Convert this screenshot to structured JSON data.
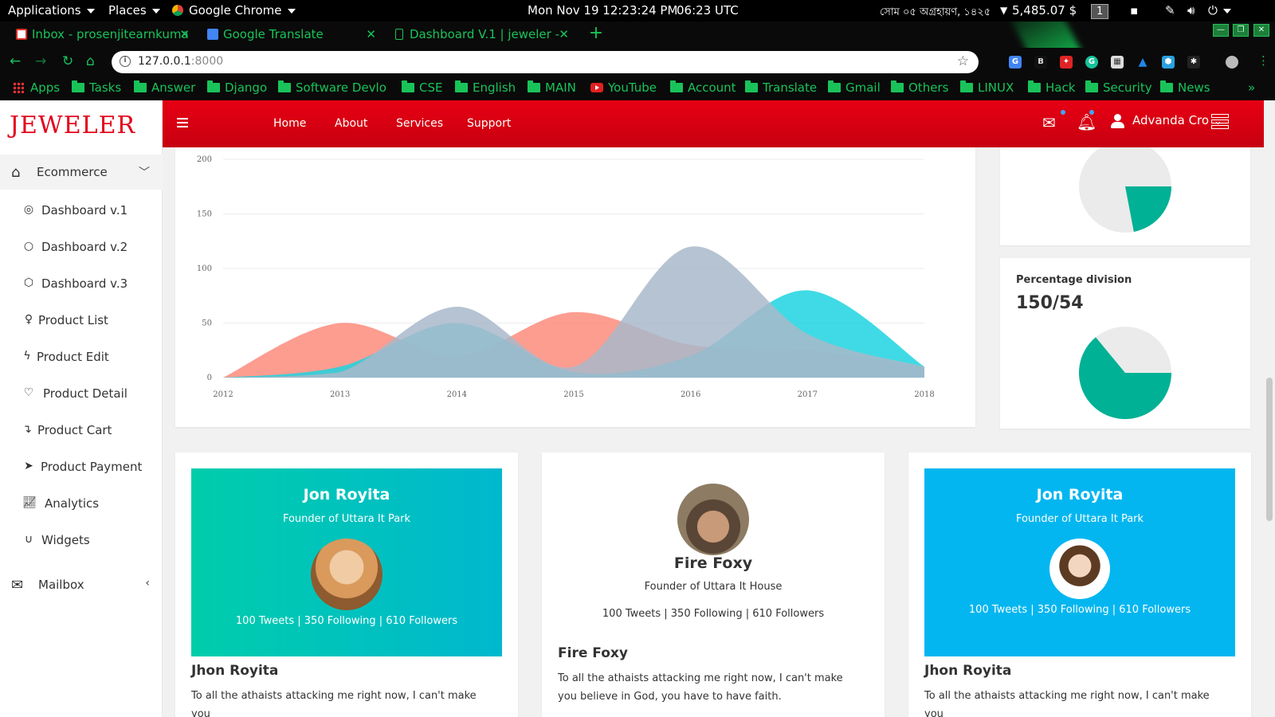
{
  "os": {
    "applications": "Applications",
    "places": "Places",
    "browser": "Google Chrome",
    "datetime": "Mon Nov 19  12:23:24 PM",
    "utc": "06:23 UTC",
    "bengali_date": "সোম ০৫ অগ্রহায়ণ, ১৪২৫",
    "balance": "5,485.07 $",
    "workspace": "1"
  },
  "tabs": [
    {
      "title": "Inbox - prosenjitearnkuma",
      "icon": "gmail-icon"
    },
    {
      "title": "Google Translate",
      "icon": "translate-icon"
    },
    {
      "title": "Dashboard V.1 | jeweler -",
      "icon": "page-icon"
    }
  ],
  "address": {
    "host": "127.0.0.1",
    "port": ":8000"
  },
  "bookmarks": [
    "Apps",
    "Tasks",
    "Answer",
    "Django",
    "Software Devlop",
    "CSE",
    "English",
    "MAIN",
    "YouTube",
    "Account",
    "Translate",
    "Gmail",
    "Others",
    "LINUX",
    "Hack",
    "Security",
    "News"
  ],
  "bookmarks_more": "»",
  "sidebar": {
    "logo": "JEWELER",
    "ecommerce": "Ecommerce",
    "items": [
      {
        "label": "Dashboard v.1",
        "icon": "target-icon"
      },
      {
        "label": "Dashboard v.2",
        "icon": "circle-icon"
      },
      {
        "label": "Dashboard v.3",
        "icon": "cube-icon"
      },
      {
        "label": "Product List",
        "icon": "female-icon"
      },
      {
        "label": "Product Edit",
        "icon": "bolt-icon"
      },
      {
        "label": "Product Detail",
        "icon": "heart-icon"
      },
      {
        "label": "Product Cart",
        "icon": "level-down-icon"
      },
      {
        "label": "Product Payment",
        "icon": "send-icon"
      },
      {
        "label": "Analytics",
        "icon": "line-chart-icon"
      },
      {
        "label": "Widgets",
        "icon": "magnet-icon"
      }
    ],
    "mailbox": "Mailbox"
  },
  "topnav": {
    "links": [
      "Home",
      "About",
      "Services",
      "Support"
    ],
    "user": "Advanda Cro"
  },
  "chart_data": {
    "type": "area",
    "x": [
      "2012",
      "2013",
      "2014",
      "2015",
      "2016",
      "2017",
      "2018"
    ],
    "ylim": [
      0,
      200
    ],
    "yticks": [
      0,
      50,
      100,
      150,
      200
    ],
    "grid": true,
    "series": [
      {
        "values": [
          0,
          50,
          20,
          60,
          30,
          25,
          10
        ],
        "color": "#fb8c7c"
      },
      {
        "values": [
          0,
          10,
          50,
          5,
          20,
          80,
          10
        ],
        "color": "#1dd3e0"
      },
      {
        "values": [
          0,
          5,
          65,
          10,
          120,
          40,
          10
        ],
        "color": "#a9b9ca"
      }
    ]
  },
  "pie1": {
    "fraction": 0.22,
    "color": "#00b195",
    "bg": "#ebebeb"
  },
  "pie2": {
    "title": "Percentage division",
    "value": "150/54",
    "fraction": 0.64,
    "color": "#00b195",
    "bg": "#ebebeb"
  },
  "profiles": [
    {
      "hero_name": "Jon Royita",
      "hero_role": "Founder of Uttara It Park",
      "stats": "100 Tweets | 350 Following | 610 Followers",
      "name": "Jhon Royita",
      "desc": "To all the athaists attacking me right now, I can't make you"
    },
    {
      "center_name": "Fire Foxy",
      "center_role": "Founder of Uttara It House",
      "stats": "100 Tweets | 350 Following | 610 Followers",
      "name": "Fire Foxy",
      "desc": "To all the athaists attacking me right now, I can't make you believe in God, you have to have faith."
    },
    {
      "hero_name": "Jon Royita",
      "hero_role": "Founder of Uttara It Park",
      "stats": "100 Tweets | 350 Following | 610 Followers",
      "name": "Jhon Royita",
      "desc": "To all the athaists attacking me right now, I can't make you"
    }
  ]
}
